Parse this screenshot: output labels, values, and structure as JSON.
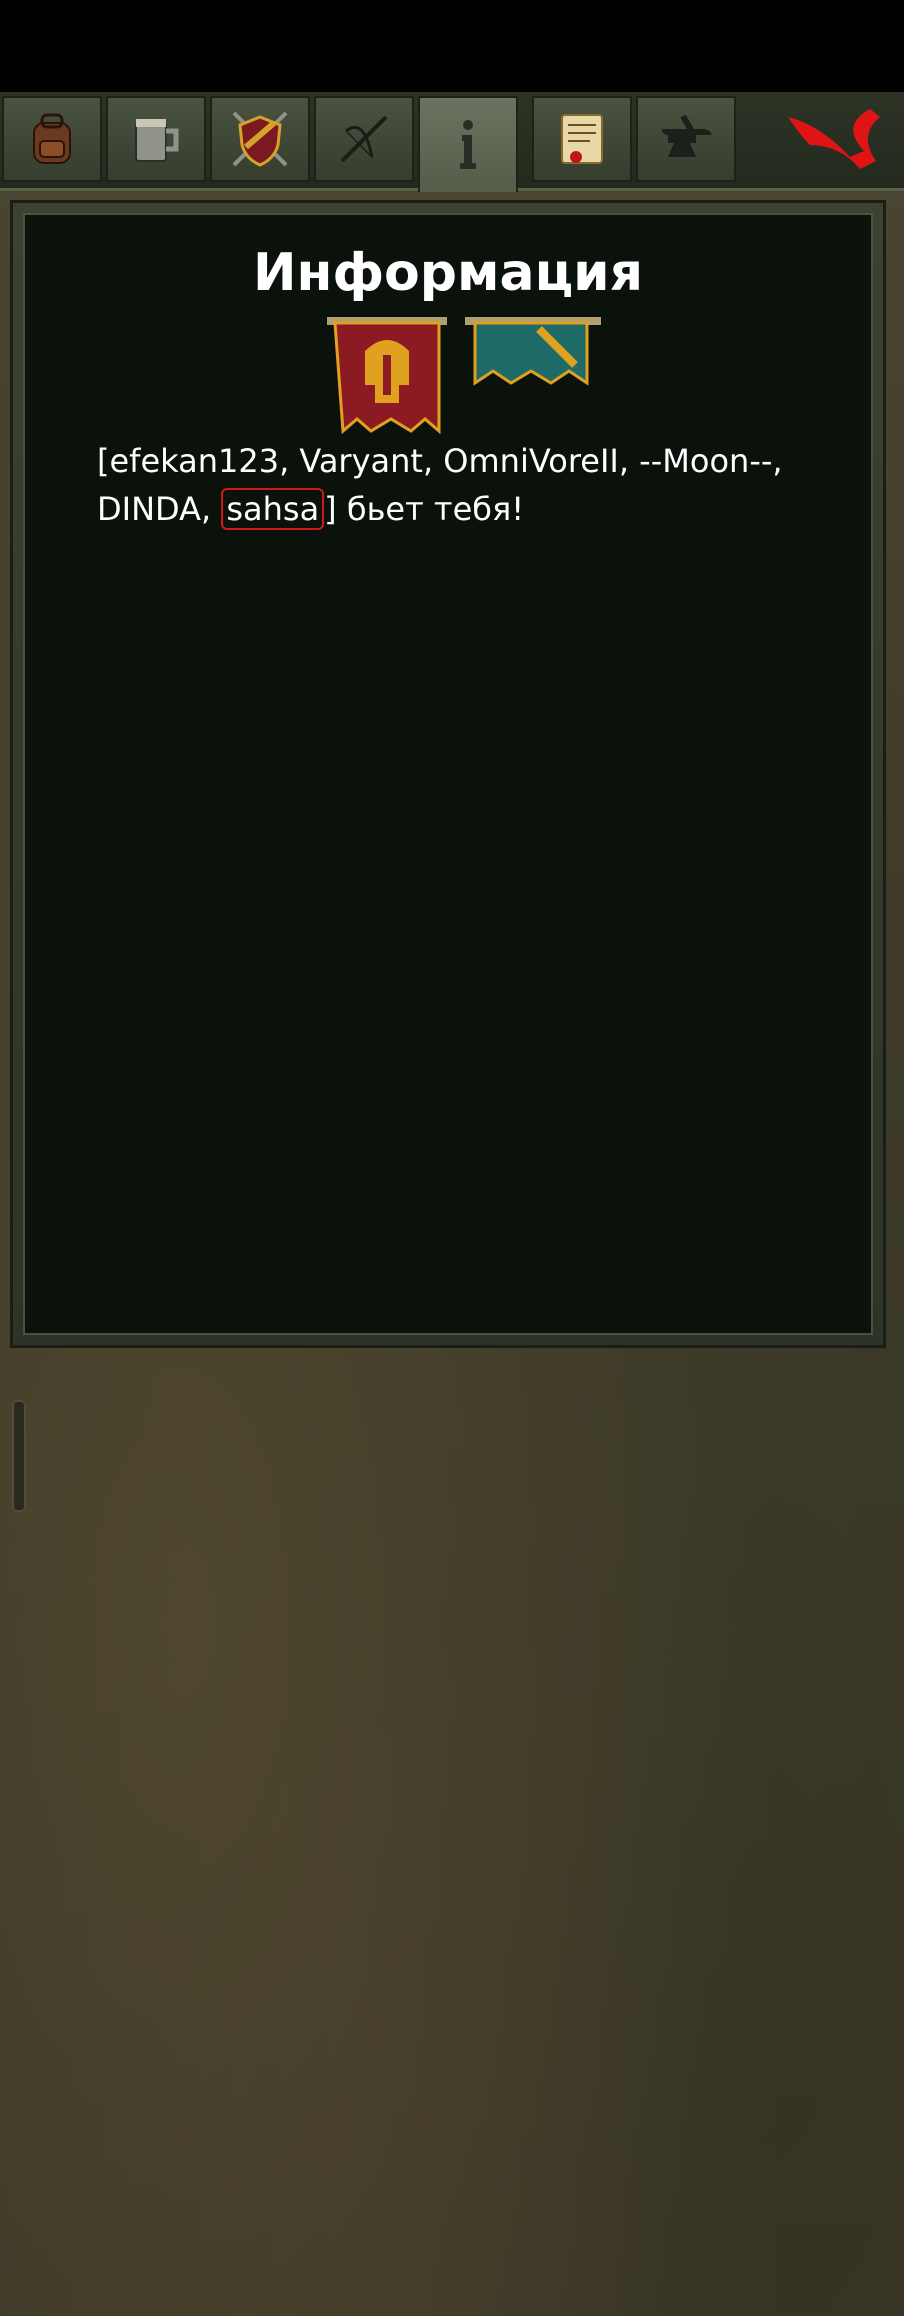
{
  "tabs": [
    {
      "name": "inventory",
      "icon": "backpack-icon",
      "active": false
    },
    {
      "name": "tavern",
      "icon": "mug-icon",
      "active": false
    },
    {
      "name": "clan",
      "icon": "shield-swords-icon",
      "active": false
    },
    {
      "name": "arena",
      "icon": "crossbow-icon",
      "active": false
    },
    {
      "name": "info",
      "icon": "info-icon",
      "active": true
    },
    {
      "name": "quests",
      "icon": "scroll-icon",
      "active": false
    },
    {
      "name": "smithy",
      "icon": "anvil-icon",
      "active": false
    }
  ],
  "panel": {
    "title": "Информация",
    "message": {
      "prefix": "[efekan123, Varyant, OmniVoreII, --Moon--, DINDA, ",
      "highlighted": "sahsa",
      "suffix": "] бьет тебя!"
    }
  },
  "colors": {
    "panel_bg": "#0b120c",
    "highlight": "#d01818",
    "close": "#e01414",
    "banner_red": "#8c1a22",
    "banner_teal": "#1e6a66",
    "gold": "#e0a020"
  }
}
